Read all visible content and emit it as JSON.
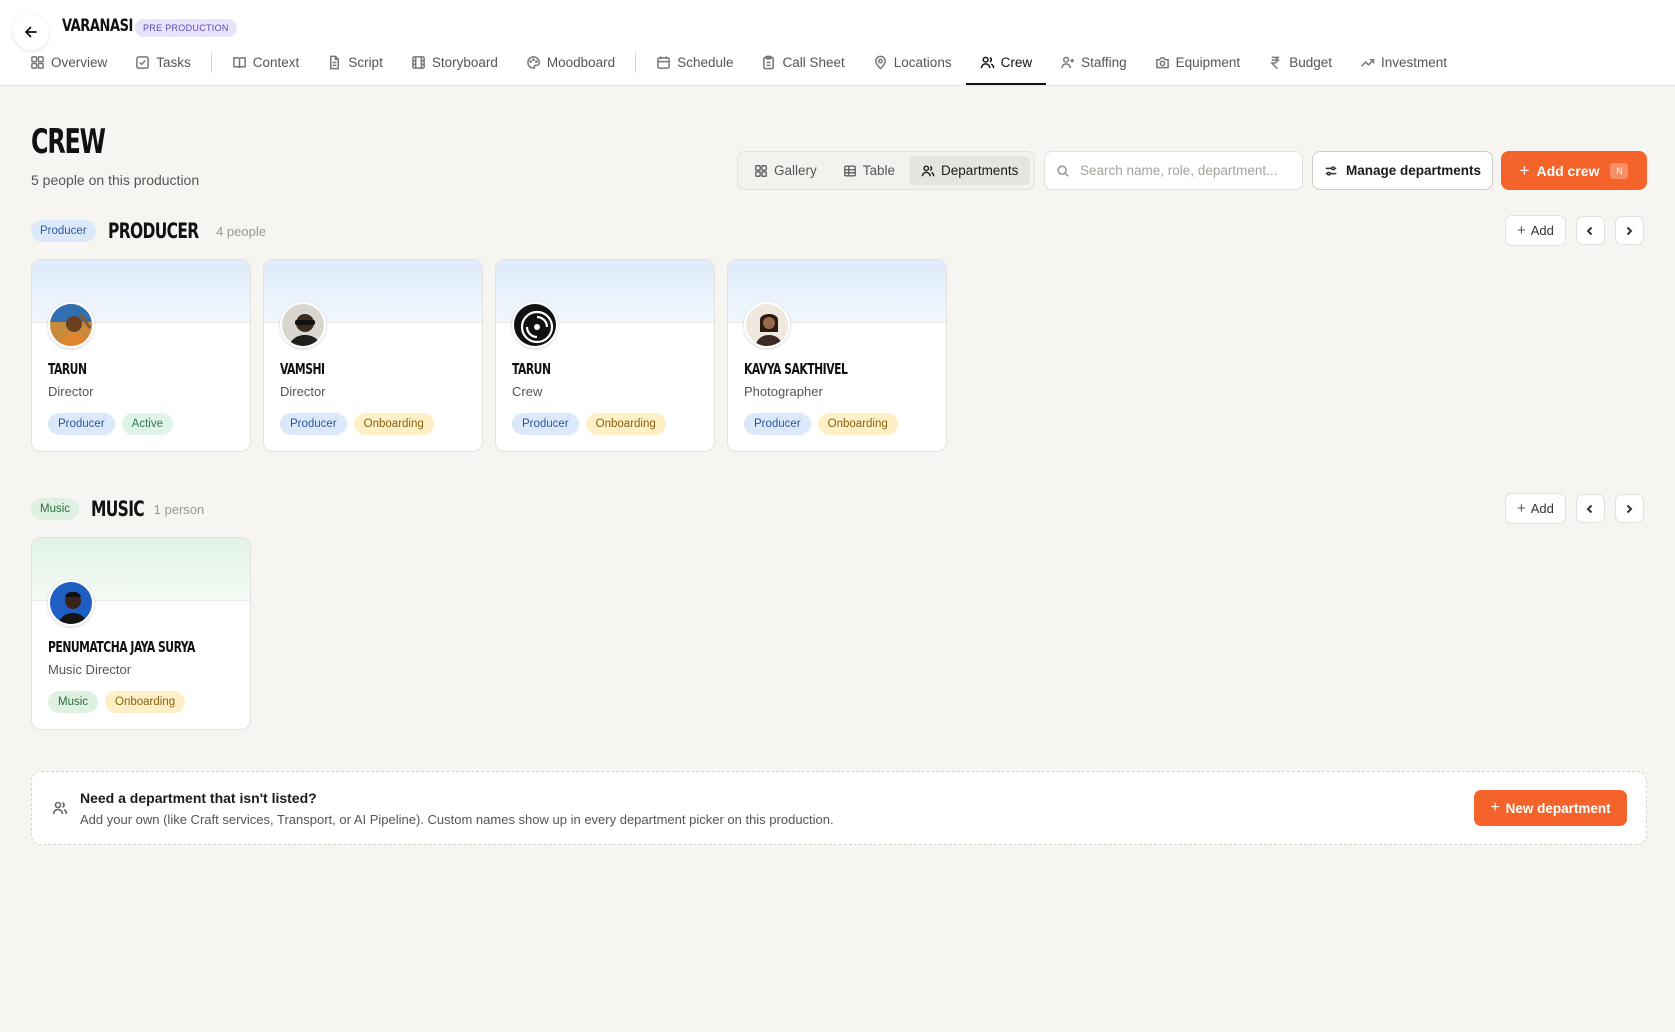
{
  "header": {
    "project_title": "VARANASI",
    "phase_badge": "PRE PRODUCTION"
  },
  "tabs": [
    {
      "label": "Overview",
      "icon": "grid-icon"
    },
    {
      "label": "Tasks",
      "icon": "checkbox-icon"
    },
    {
      "label": "Context",
      "icon": "book-icon"
    },
    {
      "label": "Script",
      "icon": "document-icon"
    },
    {
      "label": "Storyboard",
      "icon": "film-icon"
    },
    {
      "label": "Moodboard",
      "icon": "palette-icon"
    },
    {
      "label": "Schedule",
      "icon": "calendar-icon"
    },
    {
      "label": "Call Sheet",
      "icon": "clipboard-icon"
    },
    {
      "label": "Locations",
      "icon": "pin-icon"
    },
    {
      "label": "Crew",
      "icon": "users-icon",
      "active": true
    },
    {
      "label": "Staffing",
      "icon": "user-plus-icon"
    },
    {
      "label": "Equipment",
      "icon": "camera-icon"
    },
    {
      "label": "Budget",
      "icon": "rupee-icon"
    },
    {
      "label": "Investment",
      "icon": "trend-icon"
    }
  ],
  "page": {
    "title": "CREW",
    "subtitle": "5 people on this production"
  },
  "views": {
    "gallery": "Gallery",
    "table": "Table",
    "departments": "Departments",
    "active": "Departments"
  },
  "search": {
    "placeholder": "Search name, role, department...",
    "value": ""
  },
  "actions": {
    "manage_departments": "Manage departments",
    "add_crew": "Add crew",
    "add_crew_shortcut": "N",
    "section_add": "Add"
  },
  "sections": [
    {
      "chip": "Producer",
      "title": "PRODUCER",
      "count": "4 people",
      "members": [
        {
          "name": "TARUN",
          "role": "Director",
          "dept_tag": "Producer",
          "status": "Active"
        },
        {
          "name": "VAMSHI",
          "role": "Director",
          "dept_tag": "Producer",
          "status": "Onboarding"
        },
        {
          "name": "TARUN",
          "role": "Crew",
          "dept_tag": "Producer",
          "status": "Onboarding"
        },
        {
          "name": "KAVYA SAKTHIVEL",
          "role": "Photographer",
          "dept_tag": "Producer",
          "status": "Onboarding"
        }
      ]
    },
    {
      "chip": "Music",
      "title": "MUSIC",
      "count": "1 person",
      "members": [
        {
          "name": "PENUMATCHA JAYA SURYA",
          "role": "Music Director",
          "dept_tag": "Music",
          "status": "Onboarding"
        }
      ]
    }
  ],
  "footer": {
    "title": "Need a department that isn't listed?",
    "description": "Add your own (like Craft services, Transport, or AI Pipeline). Custom names show up in every department picker on this production.",
    "button": "New department"
  },
  "colors": {
    "accent": "#f4632a",
    "background": "#f6f5f2",
    "producer_chip": "#dce9fb",
    "music_chip": "#dff1e2",
    "active_tag": "#dff3e8",
    "onboarding_tag": "#fdf0c6",
    "phase_badge": "#e8e3fb"
  }
}
